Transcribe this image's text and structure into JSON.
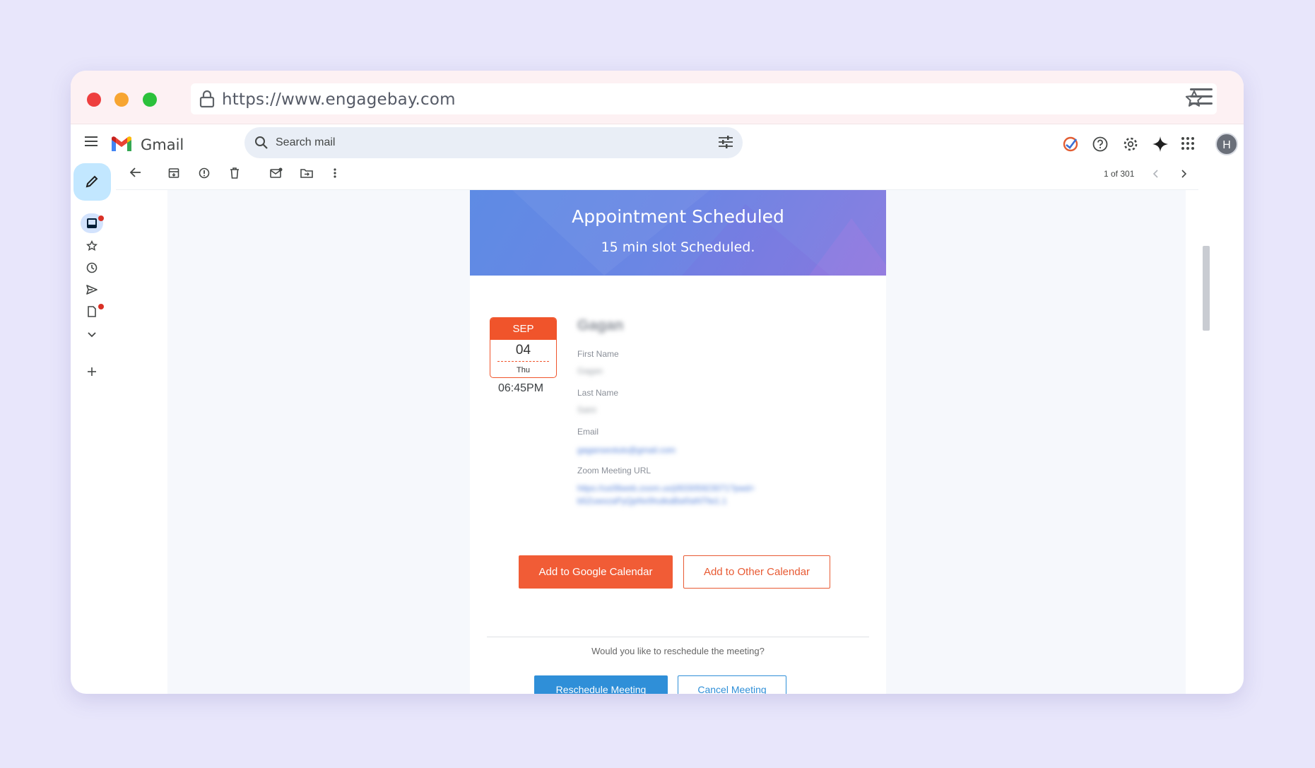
{
  "browser": {
    "url": "https://www.engagebay.com",
    "icons": [
      "lock-icon",
      "bookmark-star-icon",
      "hamburger-menu-icon"
    ]
  },
  "gmail": {
    "app_name": "Gmail",
    "search_placeholder": "Search mail",
    "avatar_letter": "H",
    "pager": "1 of 301"
  },
  "email": {
    "banner_title": "Appointment Scheduled",
    "banner_subtitle": "15 min slot Scheduled.",
    "date": {
      "month": "SEP",
      "day": "04",
      "weekday": "Thu",
      "time": "06:45PM"
    },
    "fields": {
      "name_value": "Gagan",
      "first_name_label": "First Name",
      "first_name_value": "Gagan",
      "last_name_label": "Last Name",
      "last_name_value": "Saini",
      "email_label": "Email",
      "email_value": "gaganseotuts@gmail.com",
      "zoom_label": "Zoom Meeting URL",
      "zoom_value_1": "https://us06web.zoom.us/j/83305923071?pwd=",
      "zoom_value_2": "b5ZuwxzaPyQpNv0hutkaBaI0aNTfw1.1"
    },
    "add_google_label": "Add to Google Calendar",
    "add_other_label": "Add to Other Calendar",
    "reschedule_question": "Would you like to reschedule the meeting?",
    "reschedule_label": "Reschedule Meeting",
    "cancel_label": "Cancel Meeting"
  },
  "colors": {
    "accent_orange": "#f15c36",
    "accent_blue": "#2f8fd8",
    "banner_blue": "#6a86e4",
    "compose_bg": "#c2e7ff"
  }
}
